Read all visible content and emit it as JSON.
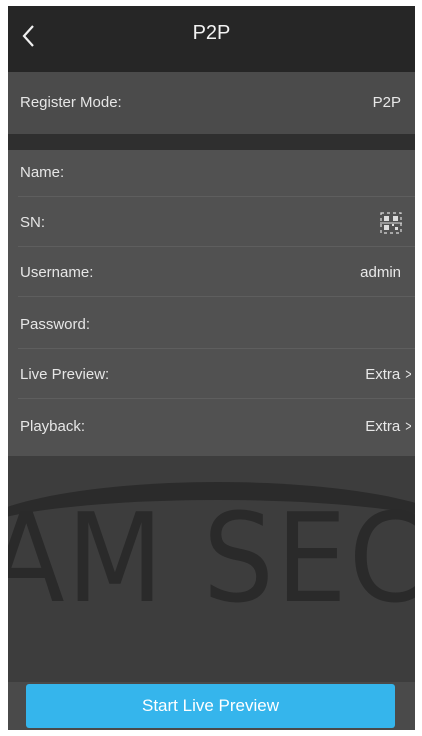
{
  "header": {
    "title": "P2P"
  },
  "register": {
    "label": "Register Mode:",
    "value": "P2P"
  },
  "fields": {
    "name_label": "Name:",
    "sn_label": "SN:",
    "username_label": "Username:",
    "username_value": "admin",
    "password_label": "Password:",
    "live_preview_label": "Live Preview:",
    "live_preview_value": "Extra",
    "playback_label": "Playback:",
    "playback_value": "Extra"
  },
  "watermark": {
    "text": "AM SEC"
  },
  "actions": {
    "start_label": "Start Live Preview"
  },
  "icons": {
    "back": "chevron-left-icon",
    "qr": "qr-scan-icon",
    "forward": "chevron-right-icon"
  },
  "colors": {
    "accent": "#35b5ec",
    "header_bg": "#262626",
    "row_bg": "#515151"
  }
}
